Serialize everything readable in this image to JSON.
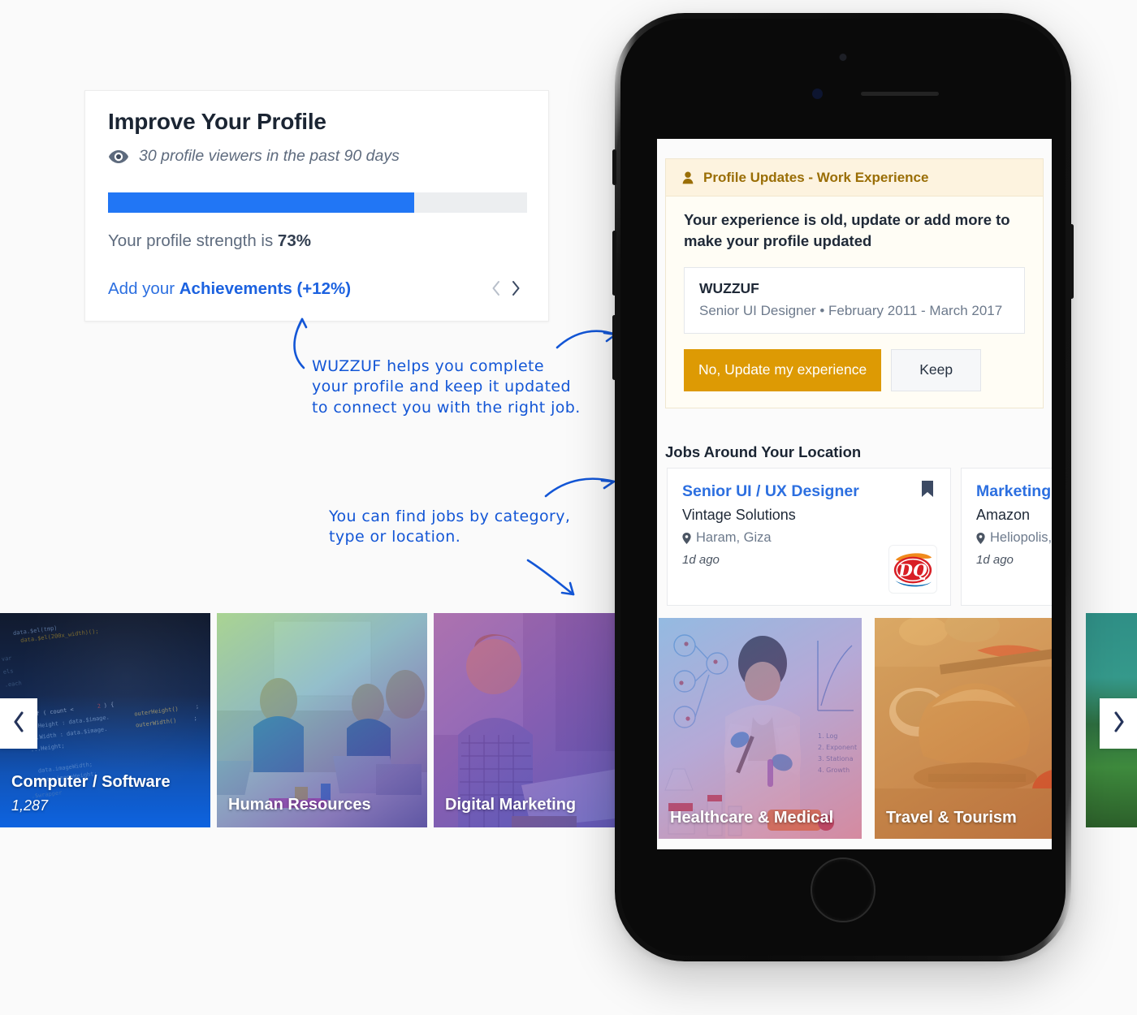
{
  "profile_card": {
    "title": "Improve Your Profile",
    "viewers_icon": "eye-icon",
    "viewers_text": "30 profile viewers in the past 90 days",
    "progress_percent": 73,
    "strength_prefix": "Your profile strength is ",
    "strength_value": "73%",
    "add_prefix": "Add your ",
    "add_highlight": "Achievements (+12%)",
    "prev_icon": "chevron-left-icon",
    "next_icon": "chevron-right-icon",
    "accent_color": "#2176f5",
    "track_color": "#eceef0"
  },
  "annotations": [
    {
      "id": "annot-profile",
      "text": "WUZZUF helps you complete\nyour profile and keep it updated\nto connect you with the right job.",
      "color": "#1356d6"
    },
    {
      "id": "annot-categories",
      "text": "You can find jobs by category,\ntype or location.",
      "color": "#1356d6"
    }
  ],
  "phone": {
    "profile_updates": {
      "header_icon": "person-icon",
      "header_title": "Profile Updates - Work Experience",
      "message": "Your experience is old, update or add more to make your profile updated",
      "experience": {
        "company": "WUZZUF",
        "detail": "Senior UI Designer • February 2011 - March 2017"
      },
      "primary_button": "No, Update my experience",
      "secondary_button": "Keep",
      "primary_color": "#dd9a04",
      "header_bg": "#fdf3df"
    },
    "jobs": {
      "section_title": "Jobs Around Your Location",
      "items": [
        {
          "title": "Senior UI / UX Designer",
          "company": "Vintage Solutions",
          "location": "Haram, Giza",
          "posted": "1d ago",
          "location_icon": "map-pin-icon",
          "bookmark_icon": "bookmark-icon",
          "logo": "DQ"
        },
        {
          "title": "Marketing",
          "company": "Amazon",
          "location": "Heliopolis, C",
          "posted": "1d ago",
          "location_icon": "map-pin-icon",
          "bookmark_icon": "bookmark-icon",
          "logo": ""
        }
      ]
    },
    "categories": [
      {
        "label": "Healthcare & Medical"
      },
      {
        "label": "Travel & Tourism"
      }
    ]
  },
  "category_strip": {
    "prev_icon": "chevron-left-icon",
    "next_icon": "chevron-right-icon",
    "items": [
      {
        "label": "Computer / Software",
        "count": "1,287"
      },
      {
        "label": "Human Resources",
        "count": ""
      },
      {
        "label": "Digital Marketing",
        "count": ""
      },
      {
        "label": "",
        "count": ""
      }
    ]
  }
}
